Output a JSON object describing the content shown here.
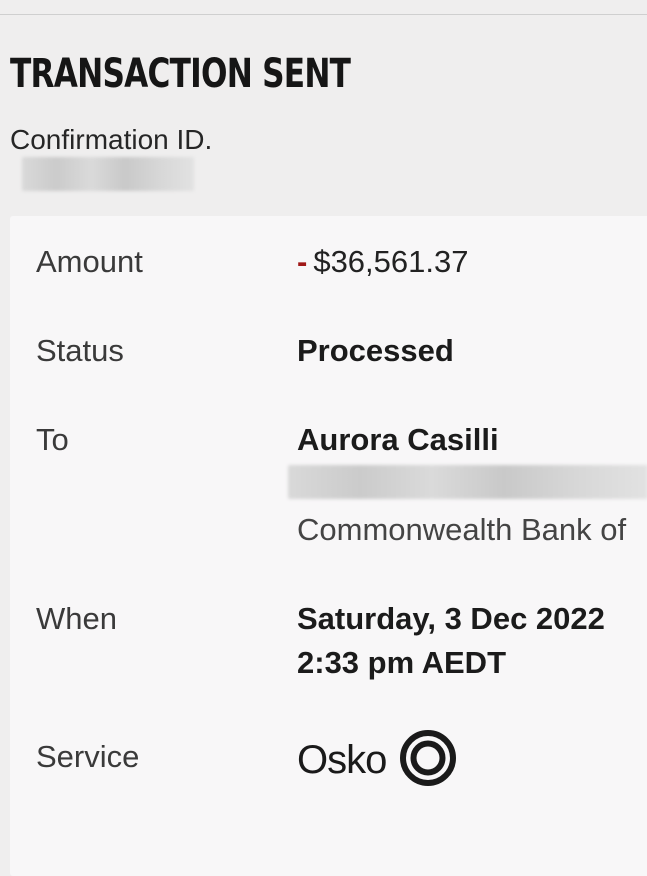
{
  "header": {
    "title": "TRANSACTION SENT",
    "confirmation_label": "Confirmation ID."
  },
  "details": {
    "amount_label": "Amount",
    "amount_sign": "-",
    "amount_value": "$36,561.37",
    "status_label": "Status",
    "status_value": "Processed",
    "to_label": "To",
    "to_name": "Aurora Casilli",
    "to_bank": "Commonwealth Bank of",
    "when_label": "When",
    "when_date": "Saturday, 3 Dec 2022",
    "when_time": "2:33 pm AEDT",
    "service_label": "Service",
    "service_value": "Osko"
  },
  "colors": {
    "negative_sign": "#a01818",
    "background": "#efeeee",
    "card": "#f8f7f8"
  },
  "icons": {
    "osko_logo": "osko-ring-logo"
  }
}
